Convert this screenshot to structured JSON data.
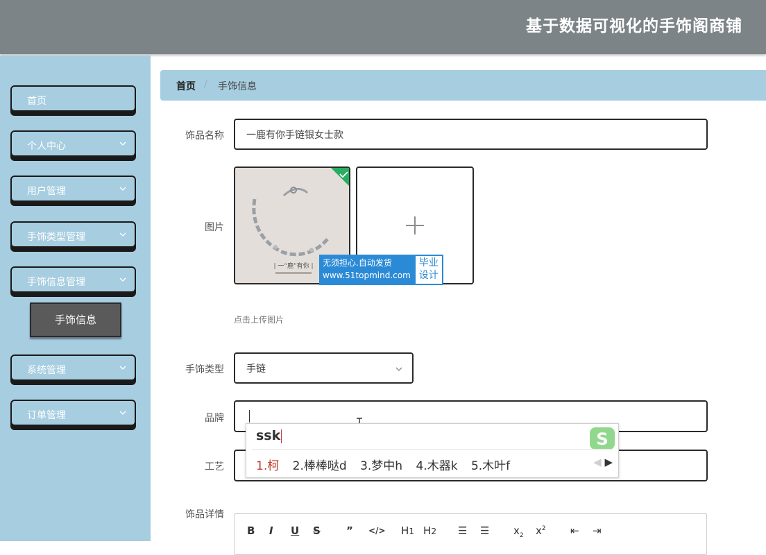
{
  "header": {
    "title": "基于数据可视化的手饰阁商铺"
  },
  "sidebar": {
    "items": [
      {
        "label": "首页",
        "has_arrow": false
      },
      {
        "label": "个人中心",
        "has_arrow": true
      },
      {
        "label": "用户管理",
        "has_arrow": true
      },
      {
        "label": "手饰类型管理",
        "has_arrow": true
      },
      {
        "label": "手饰信息管理",
        "has_arrow": true
      },
      {
        "label": "系统管理",
        "has_arrow": true
      },
      {
        "label": "订单管理",
        "has_arrow": true
      }
    ],
    "active_sub_item": "手饰信息"
  },
  "breadcrumb": {
    "home": "首页",
    "separator": "/",
    "current": "手饰信息"
  },
  "form": {
    "name": {
      "label": "饰品名称",
      "value": "一鹿有你手链银女士款"
    },
    "image": {
      "label": "图片",
      "hint": "点击上传图片",
      "thumb_caption": "| 一“鹿”有你 |"
    },
    "category": {
      "label": "手饰类型",
      "value": "手链"
    },
    "brand": {
      "label": "品牌",
      "value": ""
    },
    "craft": {
      "label": "工艺",
      "value": ""
    },
    "detail": {
      "label": "饰品详情"
    }
  },
  "watermark": {
    "line1": "无须担心.自动发货",
    "line2": "www.51topmind.com",
    "badge_line1": "毕业",
    "badge_line2": "设计"
  },
  "ime": {
    "composition": "ssk",
    "candidates": [
      "1.柯",
      "2.棒棒哒d",
      "3.梦中h",
      "4.木器k",
      "5.木叶f"
    ],
    "logo": "S"
  },
  "editor_toolbar": [
    "B",
    "I",
    "U",
    "S",
    "99",
    "</>",
    "H1",
    "H2",
    "ol",
    "ul",
    "x2",
    "x²",
    "outdent",
    "indent"
  ],
  "colors": {
    "topbar": "#7c8487",
    "sidebar": "#a7cde0",
    "active_sub": "#5a5a5a",
    "upload_check": "#27ae60",
    "watermark": "#2b8ad6"
  }
}
